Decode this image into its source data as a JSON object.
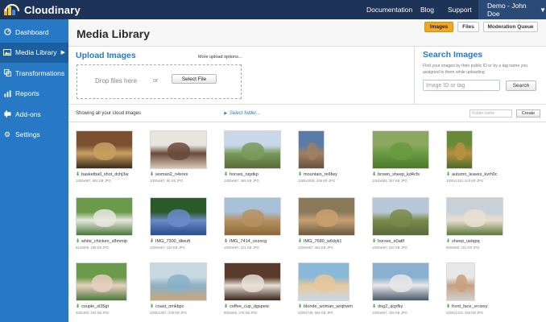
{
  "brand": {
    "name": "Cloudinary"
  },
  "topnav": {
    "documentation": "Documentation",
    "blog": "Blog",
    "support": "Support",
    "user": "Demo - John Doe"
  },
  "sidebar": {
    "items": [
      {
        "label": "Dashboard",
        "icon": "dashboard-icon"
      },
      {
        "label": "Media Library",
        "icon": "image-icon"
      },
      {
        "label": "Transformations",
        "icon": "transform-icon"
      },
      {
        "label": "Reports",
        "icon": "chart-icon"
      },
      {
        "label": "Add-ons",
        "icon": "puzzle-icon"
      },
      {
        "label": "Settings",
        "icon": "gear-icon"
      }
    ]
  },
  "header": {
    "title": "Media Library",
    "tabs": {
      "images": "Images",
      "files": "Files",
      "queue": "Moderation Queue"
    }
  },
  "upload": {
    "title": "Upload Images",
    "more": "More upload options...",
    "drop": "Drop files here",
    "or": "or",
    "select": "Select File"
  },
  "search": {
    "title": "Search Images",
    "help": "Find your images by their public ID or by a tag name you assigned to them while uploading",
    "placeholder": "Image ID or tag",
    "button": "Search"
  },
  "toolbar": {
    "showing": "Showing all your cloud images",
    "select_folder": "Select folder...",
    "folder_placeholder": "Folder name",
    "create": "Create"
  },
  "images": [
    {
      "name": "basketball_shot_dchj3w",
      "meta": "1000x667, 602 KB JPG",
      "colors": [
        "#7a5030",
        "#c9a060",
        "#3a2a1a"
      ]
    },
    {
      "name": "woman2_n4xrex",
      "meta": "1000x667, 60 KB JPG",
      "colors": [
        "#e8e4de",
        "#6a4a3a",
        "#d8c8b8"
      ]
    },
    {
      "name": "horses_nqstkp",
      "meta": "1000x667, 365 KB JPG",
      "colors": [
        "#c8d8e8",
        "#7a9a5a",
        "#5a6a3a"
      ]
    },
    {
      "name": "mountain_re6fwy",
      "meta": "1365x2048, 308 KB JPG",
      "colors": [
        "#5a7aa8",
        "#a08060",
        "#6a5040"
      ]
    },
    {
      "name": "brown_sheep_kd4cfs",
      "meta": "1024x683, 207 KB JPG",
      "colors": [
        "#8aa860",
        "#6a9a40",
        "#4a7a2a"
      ]
    },
    {
      "name": "autumn_leaves_kvrh0c",
      "meta": "1000x1333, 543 KB JPG",
      "colors": [
        "#6a8a3a",
        "#b89040",
        "#4a6a2a"
      ]
    },
    {
      "name": "white_chicken_s8mmip",
      "meta": "512x606, 190 KB JPG",
      "colors": [
        "#6a9a4a",
        "#e8e8e0",
        "#4a7a3a"
      ]
    },
    {
      "name": "IMG_7300_dlwuft",
      "meta": "1000x667, 129 KB JPG",
      "colors": [
        "#2a5a2a",
        "#6a8ac8",
        "#2a4a8a"
      ]
    },
    {
      "name": "IMG_7414_vezocg",
      "meta": "1000x667, 221 KB JPG",
      "colors": [
        "#a8c0d8",
        "#b89060",
        "#8a6a3a"
      ]
    },
    {
      "name": "IMG_7680_w6dyk1",
      "meta": "1000x667, 262 KB JPG",
      "colors": [
        "#8a7a5a",
        "#c8a070",
        "#6a5a40"
      ]
    },
    {
      "name": "horses_e0atlf",
      "meta": "1000x667, 220 KB JPG",
      "colors": [
        "#b8c8d8",
        "#7a8a4a",
        "#5a6a3a"
      ]
    },
    {
      "name": "sheep_uelqpq",
      "meta": "800x560, 151 KB JPG",
      "colors": [
        "#c8d0d8",
        "#e8e0d0",
        "#5a7a3a"
      ]
    },
    {
      "name": "couple_sl35gt",
      "meta": "400x300, 202 KB JPG",
      "colors": [
        "#6a9a4a",
        "#e8d0c0",
        "#4a7a3a"
      ]
    },
    {
      "name": "coast_omkbpc",
      "meta": "1000x1067, 219 KB JPG",
      "colors": [
        "#c8d8e0",
        "#8ab0c8",
        "#c8a878"
      ]
    },
    {
      "name": "coffee_cup_dgspew",
      "meta": "800x555, 478 KB JPG",
      "colors": [
        "#5a3a2a",
        "#e8e0d8",
        "#3a2418"
      ]
    },
    {
      "name": "blonde_woman_wrqhwm",
      "meta": "1000x749, 505 KB JPG",
      "colors": [
        "#8ab8d8",
        "#e8c89a",
        "#c8d8e8"
      ]
    },
    {
      "name": "dog2_qcpfky",
      "meta": "1000x667, 439 KB JPG",
      "colors": [
        "#8ab0d0",
        "#e8e8e8",
        "#4a5a6a"
      ]
    },
    {
      "name": "front_face_vrcwxy",
      "meta": "1000x1333, 265 KB JPG",
      "colors": [
        "#e8e8e8",
        "#c8a080",
        "#d0d0d0"
      ]
    }
  ]
}
